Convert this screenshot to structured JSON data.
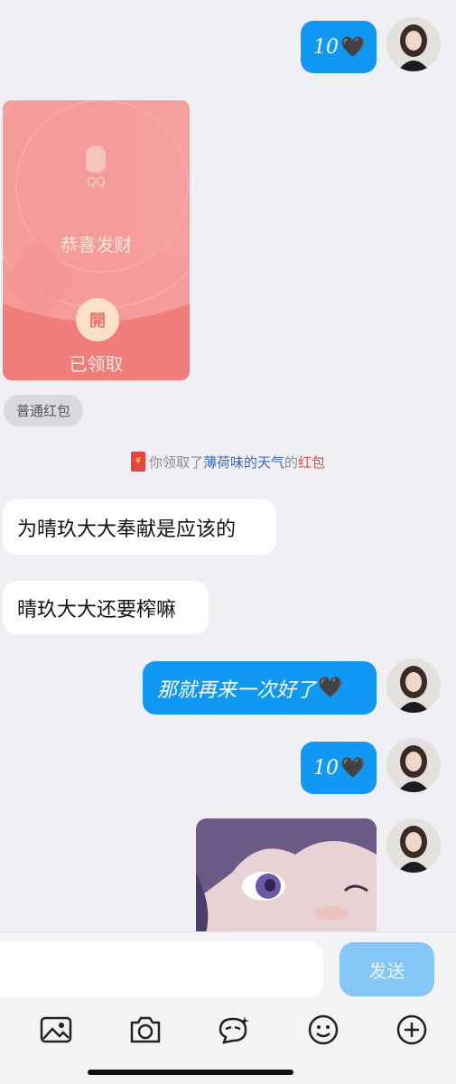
{
  "messages": {
    "out_1": {
      "text": "10",
      "emoji": "🖤"
    },
    "red_packet": {
      "brand": "QQ",
      "title": "恭喜发财",
      "open_char": "開",
      "status": "已领取",
      "type_label": "普通红包"
    },
    "system": {
      "icon": "¥",
      "prefix": "你领取了",
      "name": "薄荷味的天气",
      "mid": "的",
      "suffix": "红包"
    },
    "in_1": {
      "text": "为晴玖大大奉献是应该的"
    },
    "in_2": {
      "text": "晴玖大大还要榨嘛"
    },
    "out_2": {
      "text": "那就再来一次好了",
      "emoji": "🖤"
    },
    "out_3": {
      "text": "10",
      "emoji": "🖤"
    }
  },
  "input": {
    "placeholder": "",
    "send_label": "发送"
  },
  "toolbar": [
    "image-icon",
    "camera-icon",
    "sticker-icon",
    "emoji-icon",
    "plus-icon"
  ],
  "colors": {
    "bubble_out": "#0f99f5",
    "red_packet": "#f59a98",
    "send_disabled": "#84c7f7"
  }
}
